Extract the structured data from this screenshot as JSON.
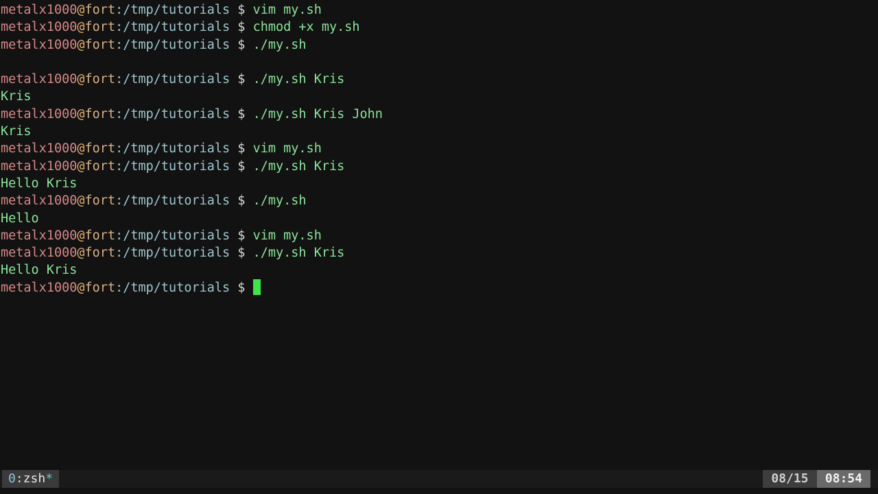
{
  "terminal": {
    "prompt": {
      "user": "metalx1000",
      "at": "@",
      "host": "fort",
      "path": ":/tmp/tutorials",
      "symbol": " $ "
    },
    "lines": [
      {
        "type": "prompt",
        "command": "vim my.sh"
      },
      {
        "type": "prompt",
        "command": "chmod +x my.sh"
      },
      {
        "type": "prompt",
        "command": "./my.sh"
      },
      {
        "type": "output",
        "text": ""
      },
      {
        "type": "prompt",
        "command": "./my.sh Kris"
      },
      {
        "type": "output",
        "text": "Kris"
      },
      {
        "type": "prompt",
        "command": "./my.sh Kris John"
      },
      {
        "type": "output",
        "text": "Kris"
      },
      {
        "type": "prompt",
        "command": "vim my.sh"
      },
      {
        "type": "prompt",
        "command": "./my.sh Kris"
      },
      {
        "type": "output",
        "text": "Hello Kris"
      },
      {
        "type": "prompt",
        "command": "./my.sh"
      },
      {
        "type": "output",
        "text": "Hello"
      },
      {
        "type": "prompt",
        "command": "vim my.sh"
      },
      {
        "type": "prompt",
        "command": "./my.sh Kris"
      },
      {
        "type": "output",
        "text": "Hello Kris"
      },
      {
        "type": "prompt",
        "command": "",
        "cursor": true
      }
    ]
  },
  "statusbar": {
    "window_index": "0",
    "window_sep": ":",
    "window_name": "zsh",
    "window_flag": "*",
    "date": "08/15",
    "time": "08:54"
  },
  "colors": {
    "background": "#121212",
    "user": "#d78787",
    "host": "#d7af87",
    "path": "#9fc6cf",
    "command": "#8be49a",
    "cursor": "#3ee44a"
  }
}
